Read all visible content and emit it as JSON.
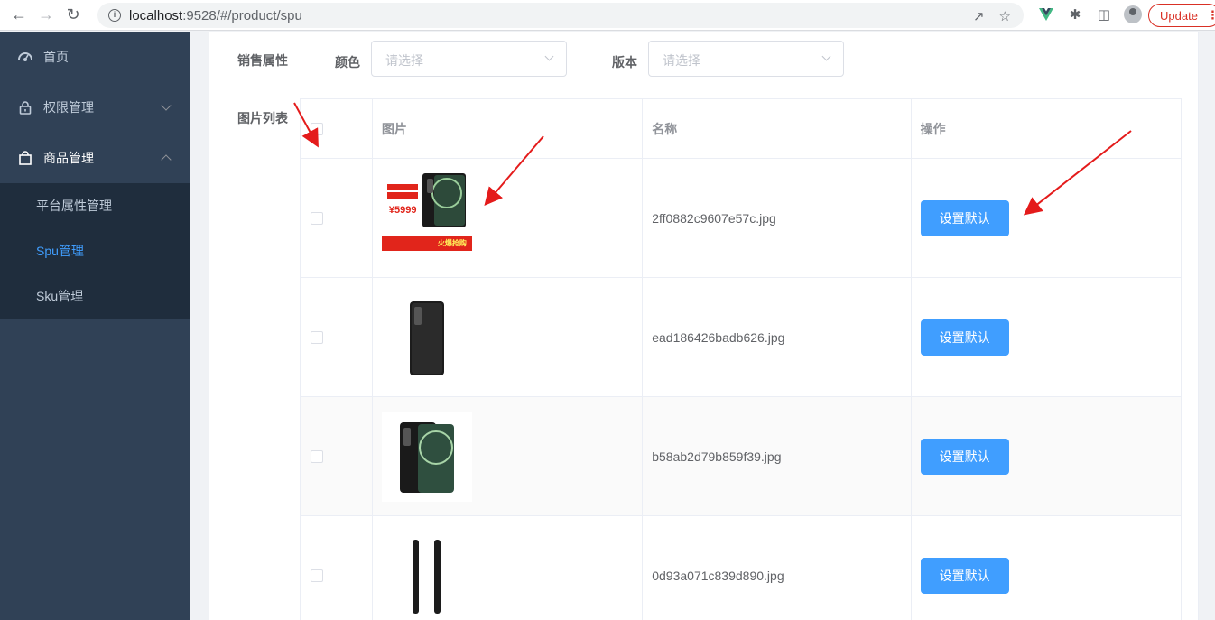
{
  "browser": {
    "url_host": "localhost",
    "url_rest": ":9528/#/product/spu",
    "update_label": "Update"
  },
  "sidebar": {
    "items": [
      {
        "label": "首页",
        "icon": "dashboard-icon"
      },
      {
        "label": "权限管理",
        "icon": "lock-icon"
      },
      {
        "label": "商品管理",
        "icon": "shopping-bag-icon"
      }
    ],
    "sub_items": [
      {
        "label": "平台属性管理"
      },
      {
        "label": "Spu管理"
      },
      {
        "label": "Sku管理"
      }
    ]
  },
  "form": {
    "sale_attr_label": "销售属性",
    "color_label": "颜色",
    "color_placeholder": "请选择",
    "version_label": "版本",
    "version_placeholder": "请选择",
    "image_list_label": "图片列表"
  },
  "table": {
    "headers": [
      "",
      "图片",
      "名称",
      "操作"
    ],
    "rows": [
      {
        "name": "2ff0882c9607e57c.jpg",
        "action": "设置默认",
        "promo_price": "¥5999",
        "promo_text": "火爆抢购"
      },
      {
        "name": "ead186426badb626.jpg",
        "action": "设置默认"
      },
      {
        "name": "b58ab2d79b859f39.jpg",
        "action": "设置默认"
      },
      {
        "name": "0d93a071c839d890.jpg",
        "action": "设置默认"
      }
    ]
  },
  "colors": {
    "sidebar_bg": "#304156",
    "submenu_bg": "#1f2d3d",
    "primary": "#409eff",
    "annotation_arrow": "#e41b1b"
  }
}
